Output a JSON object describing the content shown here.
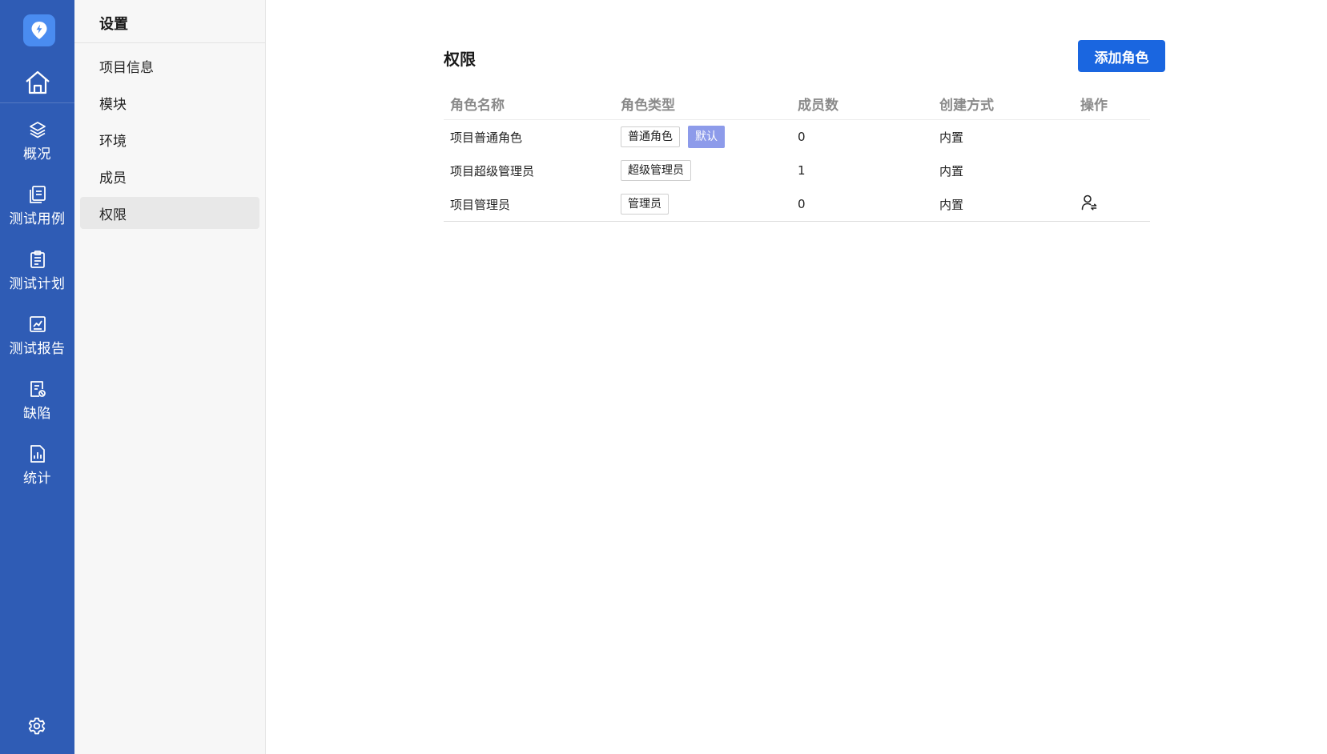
{
  "colors": {
    "rail_bg": "#2f5cb5",
    "logo_bg": "#4a8cf0",
    "primary_button": "#1a66e0",
    "default_tag": "#8d9bea",
    "submenu_active": "#e8e8e8"
  },
  "rail": {
    "logo_icon": "bolt-location-icon",
    "home_icon": "home-icon",
    "items": [
      {
        "label": "概况",
        "icon": "layers-icon"
      },
      {
        "label": "测试用例",
        "icon": "document-stack-icon"
      },
      {
        "label": "测试计划",
        "icon": "clipboard-list-icon"
      },
      {
        "label": "测试报告",
        "icon": "chart-report-icon"
      },
      {
        "label": "缺陷",
        "icon": "bug-document-icon"
      },
      {
        "label": "统计",
        "icon": "bar-chart-document-icon"
      }
    ],
    "settings_icon": "gear-icon"
  },
  "submenu": {
    "title": "设置",
    "items": [
      {
        "label": "项目信息",
        "active": false
      },
      {
        "label": "模块",
        "active": false
      },
      {
        "label": "环境",
        "active": false
      },
      {
        "label": "成员",
        "active": false
      },
      {
        "label": "权限",
        "active": true
      }
    ]
  },
  "main": {
    "title": "权限",
    "add_button": "添加角色",
    "table": {
      "headers": [
        "角色名称",
        "角色类型",
        "成员数",
        "创建方式",
        "操作"
      ],
      "rows": [
        {
          "name": "项目普通角色",
          "type": "普通角色",
          "default_tag": "默认",
          "members": "0",
          "created": "内置",
          "action_icon": ""
        },
        {
          "name": "项目超级管理员",
          "type": "超级管理员",
          "default_tag": "",
          "members": "1",
          "created": "内置",
          "action_icon": ""
        },
        {
          "name": "项目管理员",
          "type": "管理员",
          "default_tag": "",
          "members": "0",
          "created": "内置",
          "action_icon": "user-switch-icon"
        }
      ]
    }
  }
}
